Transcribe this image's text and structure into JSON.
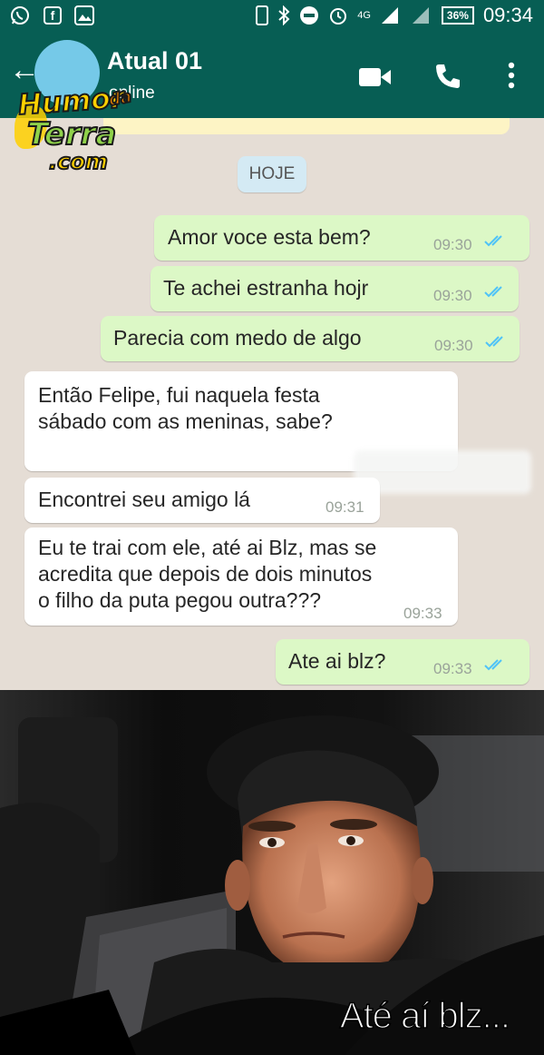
{
  "status_bar": {
    "network": "4G",
    "battery": "36%",
    "time": "09:34"
  },
  "header": {
    "contact_name": "Atual 01",
    "contact_status": "online"
  },
  "watermark": {
    "text": "Humor da Terra .com"
  },
  "chat": {
    "date_chip": "HOJE",
    "messages": [
      {
        "direction": "out",
        "text": "Amor voce esta bem?",
        "time": "09:30",
        "read": true
      },
      {
        "direction": "out",
        "text": "Te achei estranha hojr",
        "time": "09:30",
        "read": true
      },
      {
        "direction": "out",
        "text": "Parecia com medo de algo",
        "time": "09:30",
        "read": true
      },
      {
        "direction": "in",
        "line1": "Então Felipe, fui naquela festa",
        "line2": "sábado com as meninas, sabe?"
      },
      {
        "direction": "in",
        "text": "Encontrei seu amigo lá",
        "time": "09:31"
      },
      {
        "direction": "in",
        "line1": "Eu te trai com ele, até ai Blz, mas se",
        "line2": "acredita que depois de dois minutos",
        "line3": "o filho da puta pegou outra???",
        "time": "09:33"
      },
      {
        "direction": "out",
        "text": "Ate ai blz?",
        "time": "09:33",
        "read": true
      }
    ]
  },
  "meme": {
    "caption": "Até aí blz..."
  },
  "colors": {
    "header": "#075e54",
    "chat_bg": "#e5ddd5",
    "outgoing_bubble": "#dcf8c6",
    "incoming_bubble": "#ffffff",
    "read_tick": "#4fc3f7"
  }
}
